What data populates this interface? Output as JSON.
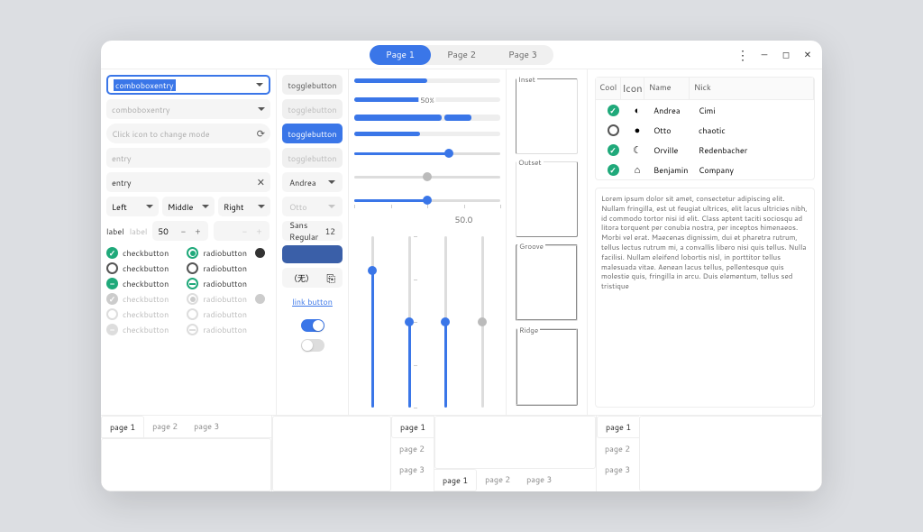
{
  "titlebar": {
    "tabs": [
      "Page 1",
      "Page 2",
      "Page 3"
    ],
    "active_tab": 0
  },
  "col1": {
    "combo_focused": "comboboxentry",
    "combo_placeholder": "comboboxentry",
    "mode_placeholder": "Click icon to change mode",
    "entry_placeholder": "entry",
    "entry_value": "entry",
    "triple": [
      "Left",
      "Middle",
      "Right"
    ],
    "label1": "label",
    "label2": "label",
    "spin_value": "50",
    "checks": [
      "checkbutton",
      "checkbutton",
      "checkbutton",
      "checkbutton",
      "checkbutton",
      "checkbutton"
    ],
    "radios": [
      "radiobutton",
      "radiobutton",
      "radiobutton",
      "radiobutton",
      "radiobutton",
      "radiobutton"
    ]
  },
  "col2": {
    "toggles": [
      "togglebutton",
      "togglebutton",
      "togglebutton",
      "togglebutton"
    ],
    "toggle_active": 2,
    "dropdown1": "Andrea",
    "dropdown2": "Otto",
    "font_label": "Sans Regular",
    "font_size": "12",
    "file_none": "（无）",
    "link": "link button"
  },
  "col3": {
    "progress_pct": "50%",
    "vslider_value": "50.0"
  },
  "col4": {
    "frames": [
      "Inset",
      "Outset",
      "Groove",
      "Ridge"
    ]
  },
  "table": {
    "headers": [
      "Cool",
      "Icon",
      "Name",
      "Nick"
    ],
    "rows": [
      {
        "cool": true,
        "icon": "◐",
        "name": "Andrea",
        "nick": "Cimi"
      },
      {
        "cool": false,
        "icon": "●",
        "name": "Otto",
        "nick": "chaotic"
      },
      {
        "cool": true,
        "icon": "☾",
        "name": "Orville",
        "nick": "Redenbacher"
      },
      {
        "cool": true,
        "icon": "⌂",
        "name": "Benjamin",
        "nick": "Company"
      }
    ]
  },
  "lorem": "Lorem ipsum dolor sit amet, consectetur adipiscing elit.\nNullam fringilla, est ut feugiat ultrices, elit lacus ultricies nibh, id commodo tortor nisi id elit.\nClass aptent taciti sociosqu ad litora torquent per conubia nostra, per inceptos himenaeos.\nMorbi vel erat. Maecenas dignissim, dui et pharetra rutrum, tellus lectus rutrum mi, a convallis libero nisi quis tellus.\nNulla facilisi. Nullam eleifend lobortis nisl, in porttitor tellus malesuada vitae.\nAenean lacus tellus, pellentesque quis molestie quis, fringilla in arcu.\nDuis elementum, tellus sed tristique",
  "notebooks": {
    "tabs": [
      "page 1",
      "page 2",
      "page 3"
    ]
  }
}
